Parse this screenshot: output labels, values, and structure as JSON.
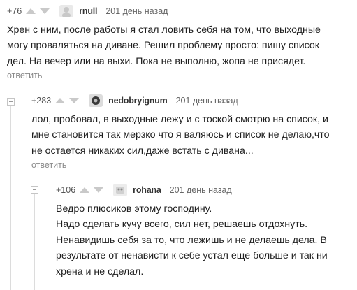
{
  "comments": [
    {
      "rating": "+76",
      "username": "rnull",
      "time": "201 день назад",
      "lines": [
        "Хрен с ним, после работы  я стал ловить себя на том, что выходные",
        "могу проваляться на диване. Решил проблему просто:  пишу список",
        "дел. На вечер или на выхи. Пока не выполню, жопа не присядет."
      ],
      "reply": "ответить"
    },
    {
      "rating": "+283",
      "username": "nedobryignum",
      "time": "201 день назад",
      "lines": [
        "лол, пробовал, в выходные лежу и с тоской смотрю на список, и",
        "мне становится так мерзко что я валяюсь и список не делаю,что",
        "не остается никаких сил,даже встать с дивана..."
      ],
      "reply": "ответить"
    },
    {
      "rating": "+106",
      "username": "rohana",
      "time": "201 день назад",
      "lines": [
        "Ведро плюсиков этому господину.",
        "Надо сделать кучу всего, сил нет, решаешь отдохнуть.",
        "Ненавидишь себя за то, что лежишь и не делаешь дела. В",
        "результате от ненависти к себе устал еще больше и так ни",
        "хрена и не сделал."
      ]
    }
  ],
  "colors": {
    "meta": "#555555",
    "reply": "#8a8a8a",
    "arrow": "#c9c9c9",
    "branch_line": "#dcdcdc"
  }
}
